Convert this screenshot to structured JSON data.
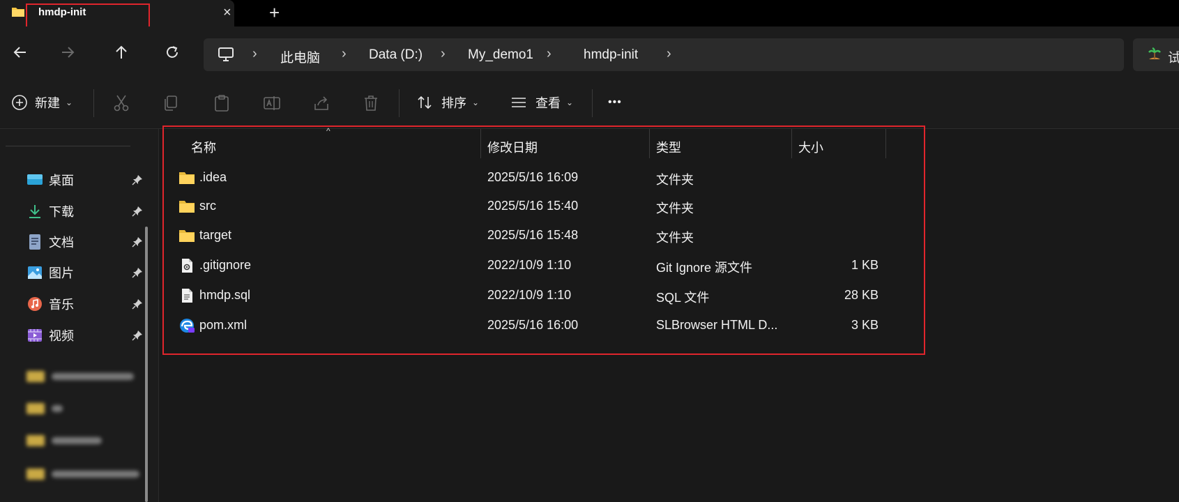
{
  "tab": {
    "title": "hmdp-init",
    "close_icon": "×",
    "new_tab_icon": "+"
  },
  "nav": {
    "breadcrumb": [
      "此电脑",
      "Data (D:)",
      "My_demo1",
      "hmdp-init"
    ],
    "search_text": "试"
  },
  "commands": {
    "new_label": "新建",
    "sort_label": "排序",
    "view_label": "查看",
    "more_label": "•••"
  },
  "sidebar": {
    "items": [
      {
        "label": "桌面",
        "icon": "desktop-icon"
      },
      {
        "label": "下载",
        "icon": "download-icon"
      },
      {
        "label": "文档",
        "icon": "document-icon"
      },
      {
        "label": "图片",
        "icon": "picture-icon"
      },
      {
        "label": "音乐",
        "icon": "music-icon"
      },
      {
        "label": "视频",
        "icon": "video-icon"
      }
    ]
  },
  "columns": {
    "name": "名称",
    "modified": "修改日期",
    "type": "类型",
    "size": "大小"
  },
  "files": [
    {
      "name": ".idea",
      "modified": "2025/5/16 16:09",
      "type": "文件夹",
      "size": "",
      "icon": "folder-icon"
    },
    {
      "name": "src",
      "modified": "2025/5/16 15:40",
      "type": "文件夹",
      "size": "",
      "icon": "folder-icon"
    },
    {
      "name": "target",
      "modified": "2025/5/16 15:48",
      "type": "文件夹",
      "size": "",
      "icon": "folder-icon"
    },
    {
      "name": ".gitignore",
      "modified": "2022/10/9 1:10",
      "type": "Git Ignore 源文件",
      "size": "1 KB",
      "icon": "config-file-icon"
    },
    {
      "name": "hmdp.sql",
      "modified": "2022/10/9 1:10",
      "type": "SQL 文件",
      "size": "28 KB",
      "icon": "text-file-icon"
    },
    {
      "name": "pom.xml",
      "modified": "2025/5/16 16:00",
      "type": "SLBrowser HTML D...",
      "size": "3 KB",
      "icon": "browser-file-icon"
    }
  ],
  "colors": {
    "accent_highlight": "#e0252c",
    "folder": "#f4c542",
    "background": "#191919"
  }
}
